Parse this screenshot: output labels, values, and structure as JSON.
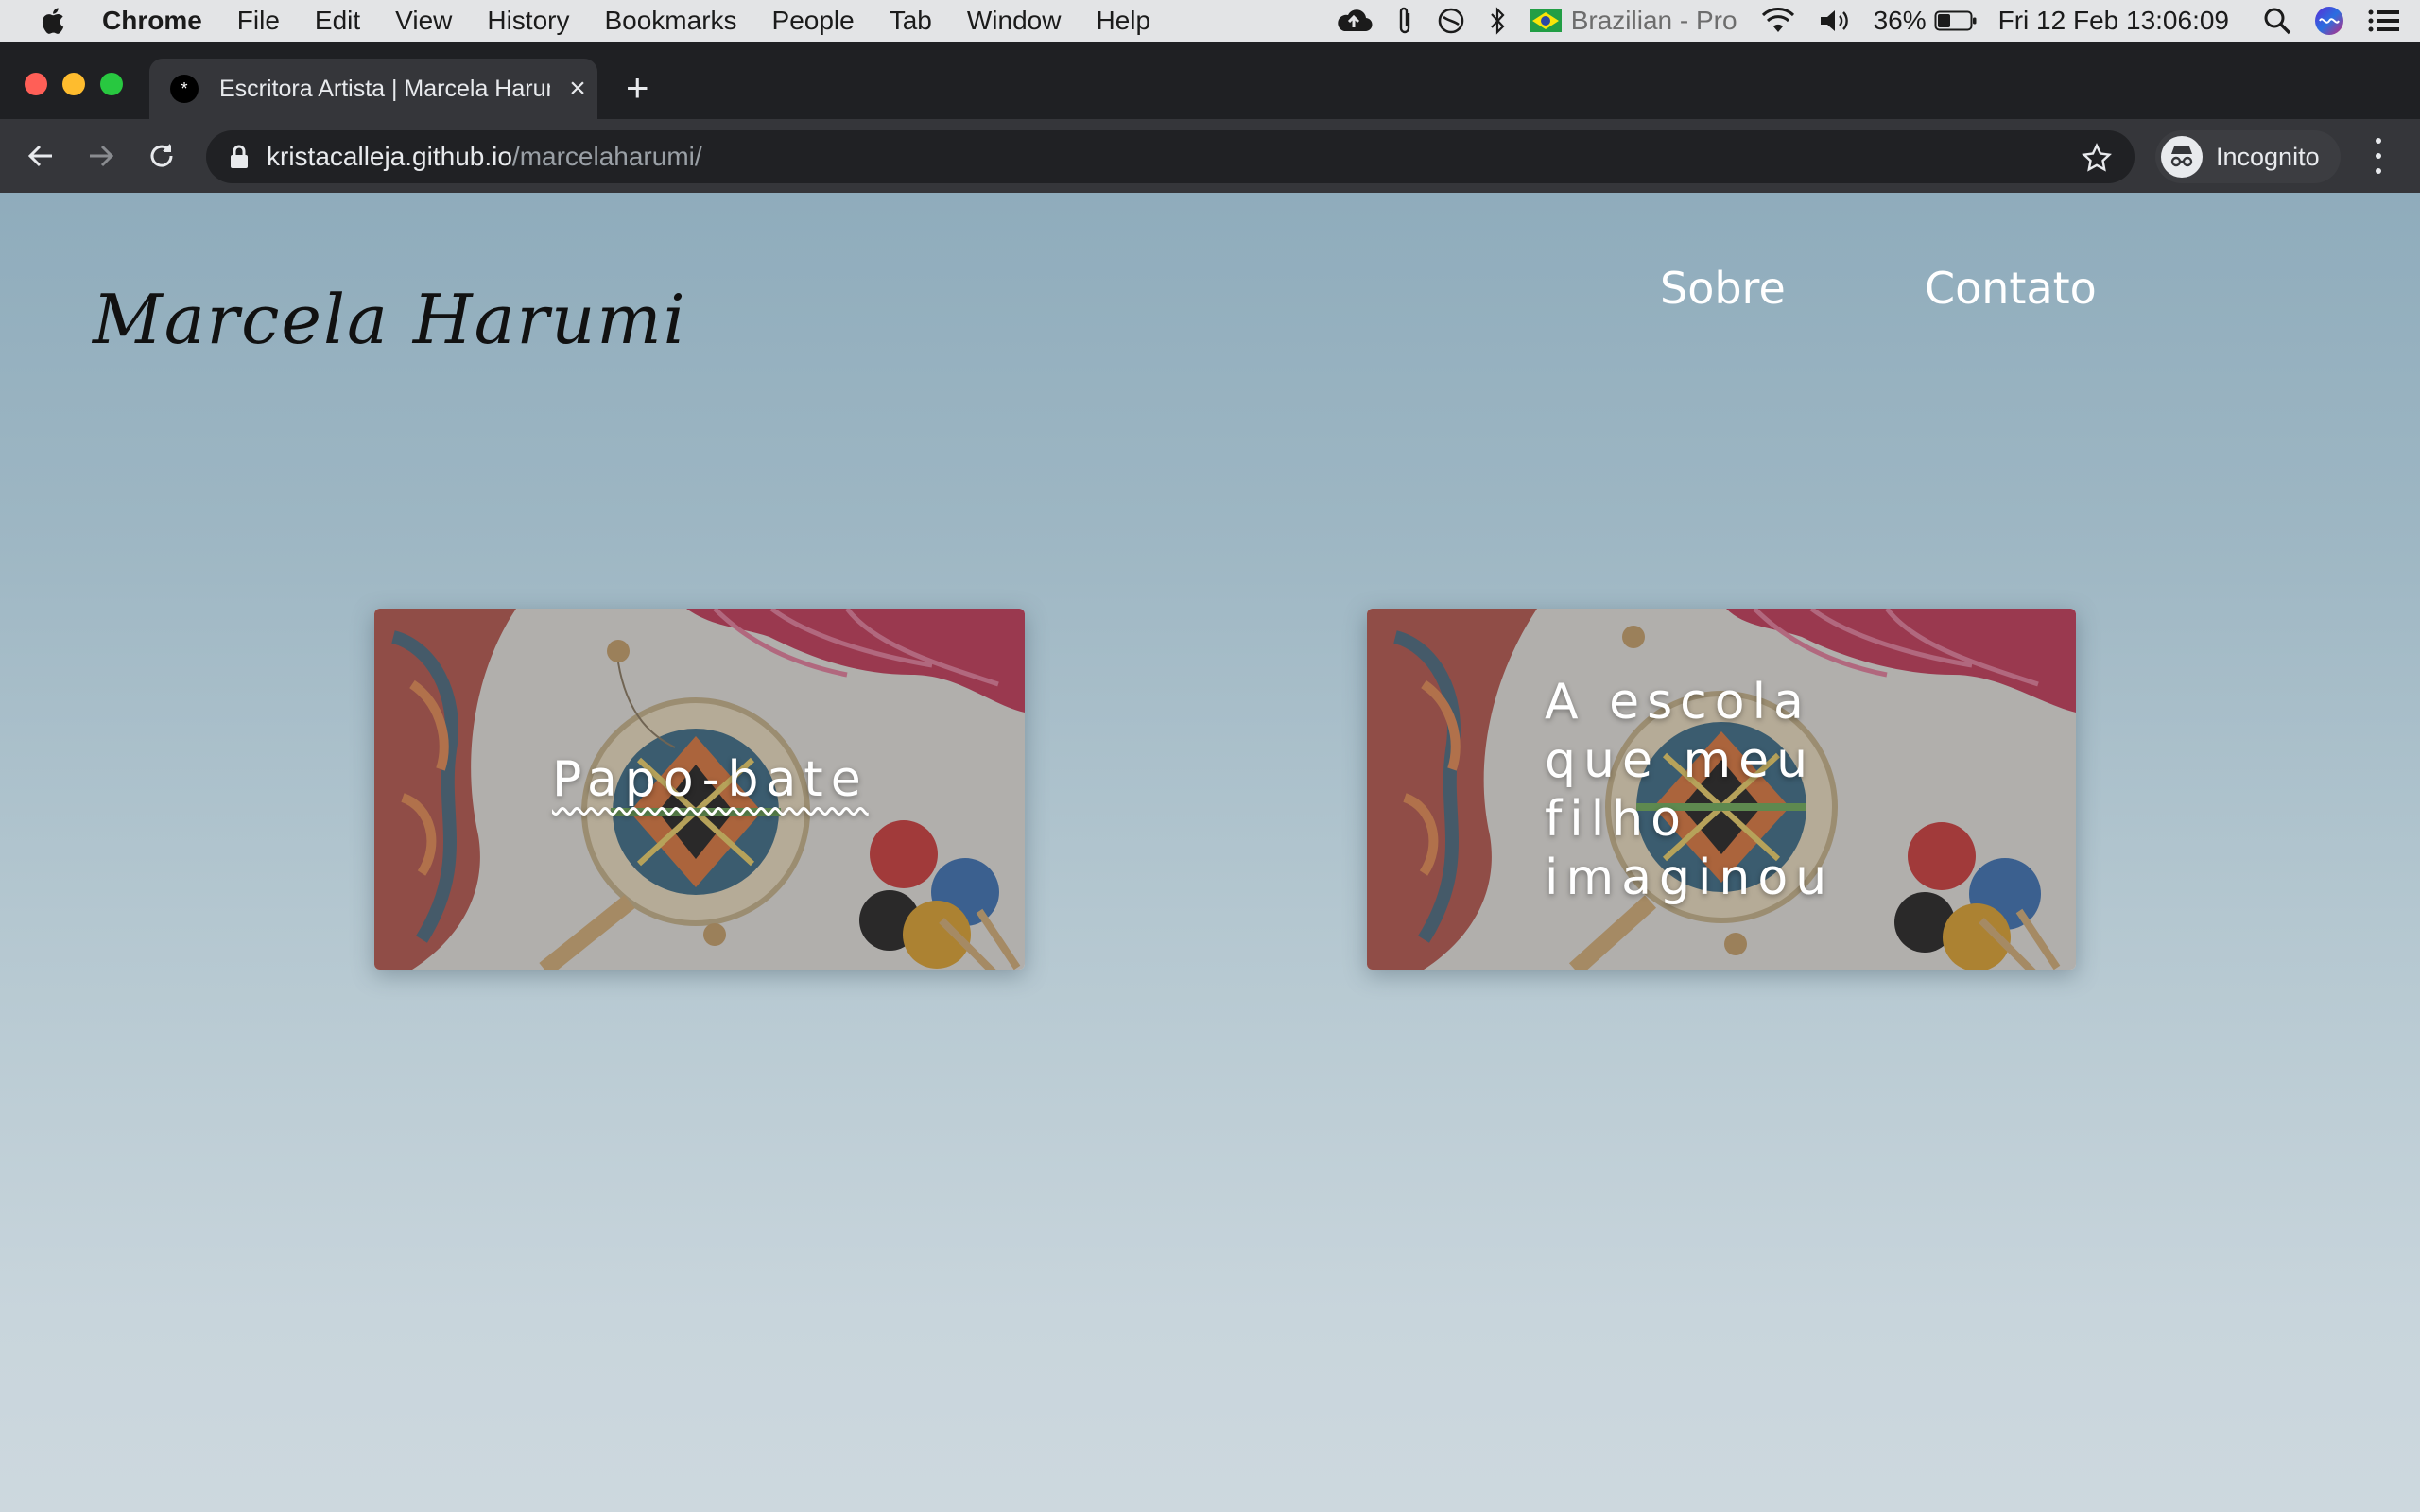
{
  "menubar": {
    "app_name": "Chrome",
    "menus": [
      "File",
      "Edit",
      "View",
      "History",
      "Bookmarks",
      "People",
      "Tab",
      "Window",
      "Help"
    ],
    "input_source": "Brazilian - Pro",
    "battery": "36%",
    "datetime": "Fri 12 Feb  13:06:09"
  },
  "browser": {
    "tab_title": "Escritora Artista | Marcela Harumi",
    "tab_favicon": "*",
    "new_tab_symbol": "+",
    "close_symbol": "×",
    "url_host": "kristacalleja.github.io",
    "url_path": "/marcelaharumi/",
    "profile_label": "Incognito"
  },
  "site": {
    "brand": "Marcela Harumi",
    "nav": [
      "Sobre",
      "Contato"
    ],
    "cards": [
      {
        "title": "Papo-bate"
      },
      {
        "title": "A escola que meu filho imaginou"
      }
    ]
  },
  "colors": {
    "page_gradient_top": "#8facbc",
    "page_gradient_bottom": "#cdd8de",
    "chrome_dark": "#35363a",
    "traffic_red": "#ff5f57",
    "traffic_yellow": "#febc2e",
    "traffic_green": "#28c840"
  },
  "icons": [
    "apple-icon",
    "cloud-upload-icon",
    "paperclip-icon",
    "do-not-disturb-icon",
    "bluetooth-icon",
    "brazil-flag-icon",
    "wifi-icon",
    "volume-icon",
    "battery-icon",
    "spotlight-search-icon",
    "siri-icon",
    "control-center-icon",
    "back-arrow-icon",
    "forward-arrow-icon",
    "reload-icon",
    "lock-icon",
    "star-icon",
    "incognito-icon",
    "kebab-menu-icon"
  ]
}
